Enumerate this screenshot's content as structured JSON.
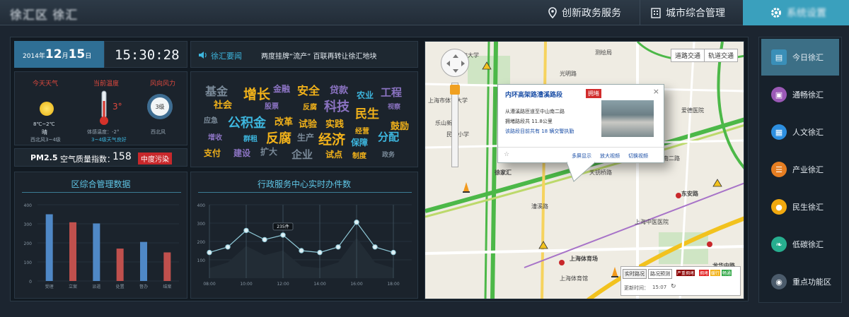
{
  "header": {
    "logo_text": "徐汇区 徐汇",
    "nav": [
      {
        "label": "创新政务服务",
        "icon": "location-pin-icon"
      },
      {
        "label": "城市综合管理",
        "icon": "building-icon"
      },
      {
        "label": "系统设置",
        "icon": "gear-icon"
      }
    ]
  },
  "datetime": {
    "year_prefix": "2014年",
    "month": "12",
    "month_unit": "月",
    "day": "15",
    "day_unit": "日",
    "time": "15:30:28"
  },
  "weather": {
    "weather_label": "今天天气",
    "temp_label": "当前温度",
    "wind_label": "风向风力",
    "temp_range": "8℃~2℃",
    "condition": "晴",
    "wind_summary": "西北风3~4级",
    "current_temp": "3°",
    "sensed_temp": "体感温度：-2°",
    "dew_point": "露点：-5°",
    "wind_note": "3~4级天气良好",
    "wind_level": "3级",
    "wind_dir": "西北风"
  },
  "air": {
    "pm_label": "PM2.5",
    "index_label": "空气质量指数：",
    "index_value": "158",
    "level": "中度污染"
  },
  "news": {
    "title": "徐汇要闻",
    "headline": "两度挂牌“流产” 百联再转让徐汇地块"
  },
  "word_cloud": [
    {
      "text": "基金",
      "color": "#7a8a99"
    },
    {
      "text": "增长",
      "color": "#f2b21a"
    },
    {
      "text": "金融",
      "color": "#8b73c2"
    },
    {
      "text": "安全",
      "color": "#f2b21a"
    },
    {
      "text": "贷款",
      "color": "#8b73c2"
    },
    {
      "text": "农业",
      "color": "#3db6de"
    },
    {
      "text": "工程",
      "color": "#8b73c2"
    },
    {
      "text": "社会",
      "color": "#f2b21a"
    },
    {
      "text": "股票",
      "color": "#8b73c2"
    },
    {
      "text": "反腐",
      "color": "#f2b21a"
    },
    {
      "text": "科技",
      "color": "#8b73c2"
    },
    {
      "text": "民生",
      "color": "#f2b21a"
    },
    {
      "text": "视察",
      "color": "#8b73c2"
    },
    {
      "text": "应急",
      "color": "#7a8a99"
    },
    {
      "text": "公积金",
      "color": "#3db6de"
    },
    {
      "text": "改革",
      "color": "#f2b21a"
    },
    {
      "text": "试验",
      "color": "#f2b21a"
    },
    {
      "text": "实践",
      "color": "#f2b21a"
    },
    {
      "text": "鼓励",
      "color": "#f2b21a"
    },
    {
      "text": "增收",
      "color": "#8b73c2"
    },
    {
      "text": "群租",
      "color": "#3db6de"
    },
    {
      "text": "反腐",
      "color": "#f2b21a"
    },
    {
      "text": "生产",
      "color": "#7a8a99"
    },
    {
      "text": "经济",
      "color": "#f2b21a"
    },
    {
      "text": "经营",
      "color": "#f2b21a"
    },
    {
      "text": "分配",
      "color": "#3db6de"
    },
    {
      "text": "支付",
      "color": "#f2b21a"
    },
    {
      "text": "建设",
      "color": "#8b73c2"
    },
    {
      "text": "扩大",
      "color": "#7a8a99"
    },
    {
      "text": "企业",
      "color": "#7a8a99"
    },
    {
      "text": "试点",
      "color": "#f2b21a"
    },
    {
      "text": "保障",
      "color": "#3db6de"
    },
    {
      "text": "制度",
      "color": "#f2b21a"
    },
    {
      "text": "政务",
      "color": "#7a8a99"
    }
  ],
  "bar_title": "区综合管理数据",
  "line_title": "行政服务中心实时办件数",
  "chart_data": [
    {
      "type": "bar",
      "title": "区综合管理数据",
      "categories": [
        "受理",
        "立案",
        "派遣",
        "处置",
        "督办",
        "结案"
      ],
      "values": [
        350,
        308,
        302,
        170,
        205,
        150
      ],
      "colors": [
        "#4f88c6",
        "#c0504d",
        "#4f88c6",
        "#c0504d",
        "#4f88c6",
        "#c0504d"
      ],
      "ylim": [
        0,
        400
      ],
      "yticks": [
        0,
        100,
        200,
        300,
        400
      ]
    },
    {
      "type": "line",
      "title": "行政服务中心实时办件数",
      "x": [
        "08:00",
        "09:00",
        "10:00",
        "11:00",
        "12:00",
        "13:00",
        "14:00",
        "15:00",
        "16:00",
        "17:00",
        "18:00",
        "19:00"
      ],
      "xticks": [
        "08:00",
        "10:00",
        "12:00",
        "14:00",
        "16:00",
        "18:00"
      ],
      "values": [
        140,
        170,
        260,
        210,
        235,
        150,
        140,
        170,
        305,
        170,
        140,
        0
      ],
      "callout_label": "235件",
      "callout_index": 4,
      "ylim": [
        0,
        400
      ],
      "yticks": [
        100,
        200,
        300,
        400
      ]
    }
  ],
  "map": {
    "tab_road": "道路交通",
    "tab_rail": "轨道交通",
    "popup": {
      "title": "内环高架路漕溪路段",
      "status": "拥堵",
      "line1": "从漕溪路匝道至中山南二路",
      "line2": "拥堵路段共 11.8公里",
      "line3": "该路段目前共有 18 辆交警执勤",
      "more": "多屏显示",
      "zoom": "放大视频",
      "switch": "切换视频"
    },
    "legend": {
      "tab_live": "实时路况",
      "tab_forecast": "路况预测",
      "jam": "严重拥堵",
      "congested": "拥堵",
      "slow": "缓行",
      "clear": "畅通",
      "update_label": "更新时间：",
      "update_time": "15:07"
    },
    "places": [
      "上海大学",
      "上海市体育大学",
      "光明路",
      "测绘局",
      "民庭小学",
      "徐家汇",
      "东安路",
      "上海体育场",
      "龙华中路",
      "上海体育馆",
      "爱德医院",
      "上海中医医院",
      "乐山新村",
      "天钥桥路",
      "漕溪路",
      "中山南二路"
    ]
  },
  "sidebar": [
    {
      "label": "今日徐汇",
      "icon": "document-icon",
      "color": "#3a8fb8"
    },
    {
      "label": "通畅徐汇",
      "icon": "train-icon",
      "color": "#9b59b6"
    },
    {
      "label": "人文徐汇",
      "icon": "book-icon",
      "color": "#2d8fe0"
    },
    {
      "label": "产业徐汇",
      "icon": "list-icon",
      "color": "#e67e22"
    },
    {
      "label": "民生徐汇",
      "icon": "person-icon",
      "color": "#f1a90f"
    },
    {
      "label": "低碳徐汇",
      "icon": "leaf-icon",
      "color": "#27ae8f"
    },
    {
      "label": "重点功能区",
      "icon": "eye-icon",
      "color": "#4b5b6b"
    }
  ]
}
